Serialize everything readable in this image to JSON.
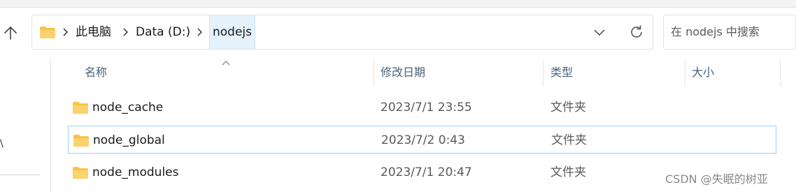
{
  "address": {
    "breadcrumbs": [
      {
        "label": "此电脑"
      },
      {
        "label": "Data (D:)"
      },
      {
        "label": "nodejs"
      }
    ]
  },
  "search": {
    "placeholder": "在 nodejs 中搜索"
  },
  "columns": {
    "name": "名称",
    "date": "修改日期",
    "type": "类型",
    "size": "大小"
  },
  "files": [
    {
      "name": "node_cache",
      "date": "2023/7/1 23:55",
      "type": "文件夹",
      "size": ""
    },
    {
      "name": "node_global",
      "date": "2023/7/2 0:43",
      "type": "文件夹",
      "size": ""
    },
    {
      "name": "node_modules",
      "date": "2023/7/1 20:47",
      "type": "文件夹",
      "size": ""
    }
  ],
  "nav_pane": {
    "hint": "\\"
  },
  "watermark": "CSDN @失眠的树亚",
  "colors": {
    "folder": "#f8c443",
    "selection_border": "#99d1ff",
    "current_crumb_bg": "#e5f1fb",
    "header_text": "#4c607a"
  },
  "icons": {
    "up": "up-arrow-icon",
    "folder": "folder-icon",
    "separator": "chevron-right-icon",
    "dropdown": "chevron-down-icon",
    "refresh": "refresh-icon",
    "sort": "sort-up-caret-icon"
  }
}
